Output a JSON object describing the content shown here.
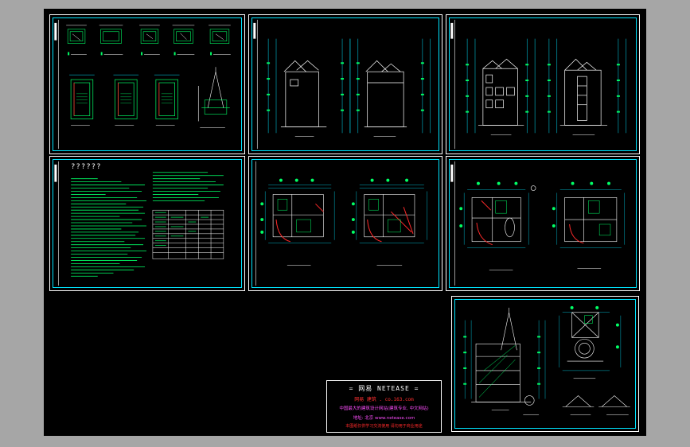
{
  "app": {
    "canvas_background": "#000000",
    "frame_color": "#ffffff",
    "border_color": "#00e5ff",
    "line_color": "#00ff66",
    "dimension_color": "#00e5ff",
    "wall_color": "#ff2a2a"
  },
  "sheets": [
    {
      "id": "typical-plans"
    },
    {
      "id": "elevations-1"
    },
    {
      "id": "elevations-2"
    },
    {
      "id": "design-notes"
    },
    {
      "id": "floor-plans-1"
    },
    {
      "id": "floor-plans-2"
    },
    {
      "id": "section-roof-details"
    }
  ],
  "notes": {
    "title": "??????"
  },
  "title_block": {
    "line1": "= 网易 NETEASE =",
    "line2": "网易 建筑 . co.163.com",
    "line3": "中国最大的建筑设计网站(建筑专业, 中文网站)",
    "line4": "地址: 北京 www.netease.com",
    "line5": "本图纸仅供学习交流使用 请勿用于商业用途"
  }
}
